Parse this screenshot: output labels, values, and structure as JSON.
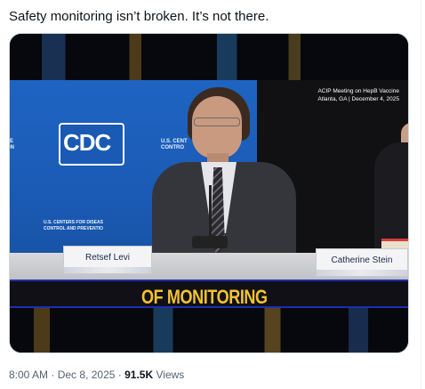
{
  "tweet": {
    "text": "Safety monitoring isn’t broken. It’s not there.",
    "time": "8:00 AM",
    "separator": "·",
    "date": "Dec 8, 2025",
    "views_count": "91.5K",
    "views_label": "Views"
  },
  "video": {
    "meeting_line1": "ACIP Meeting on HepB Vaccine",
    "meeting_line2": "Atlanta, GA | December 4, 2025",
    "cdc_logo": "CDC",
    "cdc_side_line1": "U.S. CENT",
    "cdc_side_line2": "CONTRO",
    "cdc_left_line1": "SE",
    "cdc_left_line2": "ON",
    "backdrop_line1": "U.S. CENTERS FOR DISEAS",
    "backdrop_line2": "CONTROL AND PREVENTIO",
    "nameplate_left": "Retsef Levi",
    "nameplate_right": "Catherine Stein",
    "caption": "OF MONITORING"
  }
}
